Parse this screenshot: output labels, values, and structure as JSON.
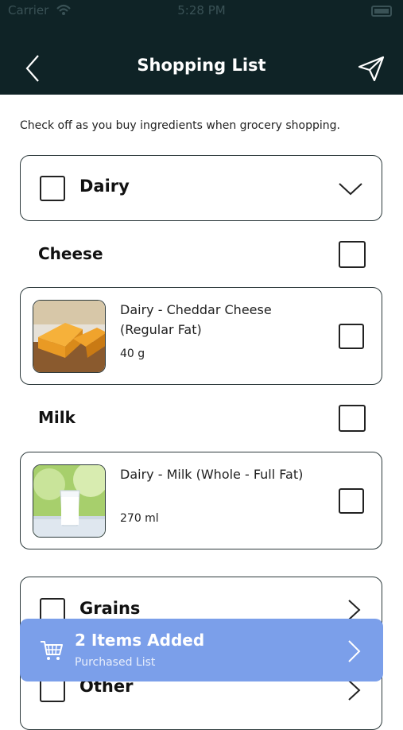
{
  "status_bar": {
    "carrier": "Carrier",
    "time": "5:28 PM"
  },
  "header": {
    "title": "Shopping List"
  },
  "intro": "Check off as you buy ingredients when grocery shopping.",
  "categories": [
    {
      "label": "Dairy",
      "subcategories": [
        {
          "label": "Cheese",
          "item": {
            "name": "Dairy - Cheddar Cheese (Regular Fat)",
            "quantity": "40 g"
          }
        },
        {
          "label": "Milk",
          "item": {
            "name": "Dairy - Milk (Whole - Full Fat)",
            "quantity": "270 ml"
          }
        }
      ]
    },
    {
      "label": "Grains"
    },
    {
      "label": "Other"
    }
  ],
  "banner": {
    "title": "2 Items Added",
    "subtitle": "Purchased List"
  },
  "colors": {
    "header_bg": "#0f2326",
    "banner_bg": "#7b9fea"
  }
}
